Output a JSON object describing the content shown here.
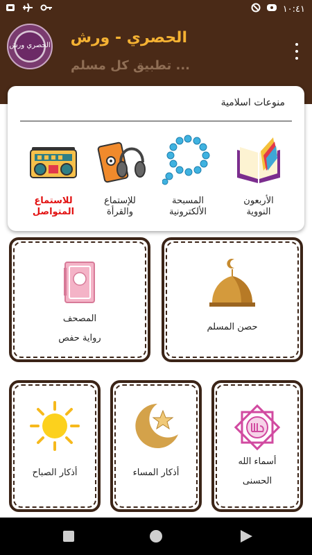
{
  "status_bar": {
    "time": "١٠:٤١"
  },
  "header": {
    "logo_text": "الحصري ورش",
    "title": "الحصري - ورش",
    "subtitle": "تطبيق كل مسلم ..."
  },
  "islamic_card": {
    "title": "منوعات اسلامية",
    "items": [
      {
        "label": "الأربعون\nالنووية",
        "icon": "book-icon"
      },
      {
        "label": "المسبحة\nالألكترونية",
        "icon": "prayer-beads-icon"
      },
      {
        "label": "للإستماع\nوالقرأة",
        "icon": "cassette-headphones-icon"
      },
      {
        "label": "للاستماع\nالمتواصل",
        "icon": "radio-icon",
        "accent": "#e21212"
      }
    ]
  },
  "tiles": {
    "hisn": {
      "label": "حصن المسلم",
      "icon": "mosque-dome-icon"
    },
    "mushaf": {
      "label": "المصحف\nرواية حفص",
      "icon": "quran-book-icon"
    },
    "asma": {
      "label": "أسماء الله\nالحسنى",
      "icon": "allah-name-icon"
    },
    "masaa": {
      "label": "أذكار المساء",
      "icon": "moon-star-icon"
    },
    "sabah": {
      "label": "أذكار الصباح",
      "icon": "sun-icon"
    }
  },
  "colors": {
    "header_bg": "#4a2a17",
    "title": "#f5b233",
    "subtitle": "#8f6e55",
    "tile_border": "#3b2417"
  }
}
